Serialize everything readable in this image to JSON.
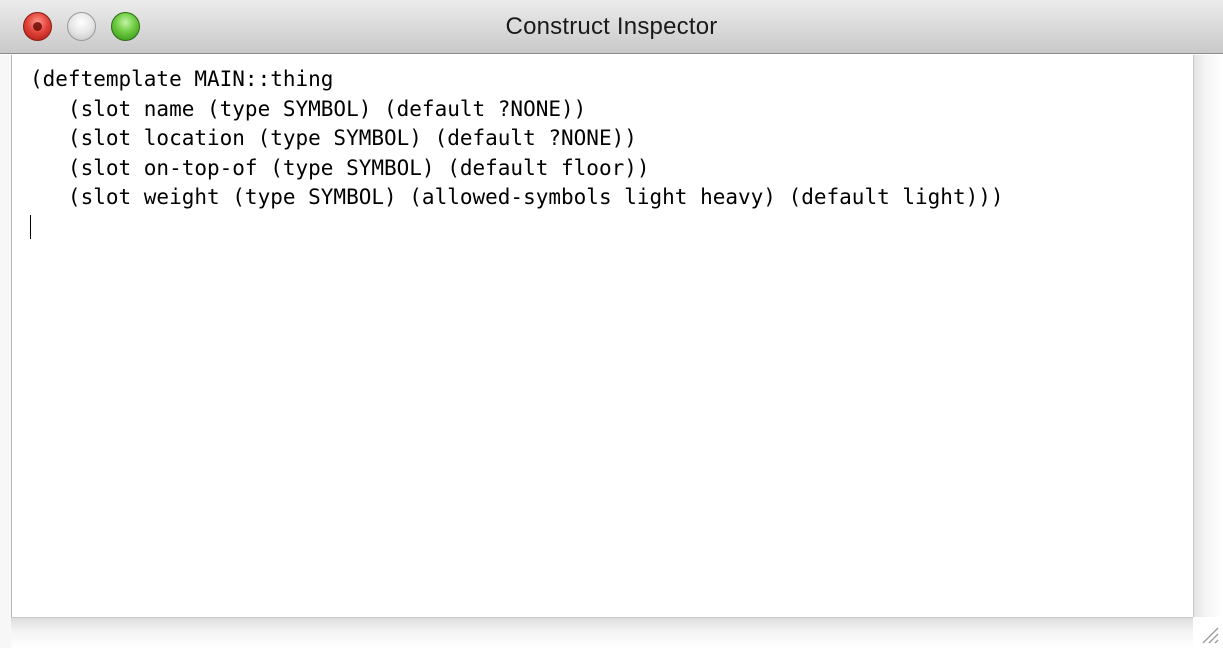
{
  "window": {
    "title": "Construct Inspector"
  },
  "traffic_lights": {
    "close_icon": "close-icon",
    "minimize_icon": "minimize-icon",
    "zoom_icon": "zoom-icon",
    "close_color": "#e2463c",
    "minimize_color": "#d9d9d9",
    "zoom_color": "#6ccb3f"
  },
  "editor": {
    "lines": [
      "(deftemplate MAIN::thing",
      "   (slot name (type SYMBOL) (default ?NONE))",
      "   (slot location (type SYMBOL) (default ?NONE))",
      "   (slot on-top-of (type SYMBOL) (default floor))",
      "   (slot weight (type SYMBOL) (allowed-symbols light heavy) (default light)))"
    ]
  }
}
